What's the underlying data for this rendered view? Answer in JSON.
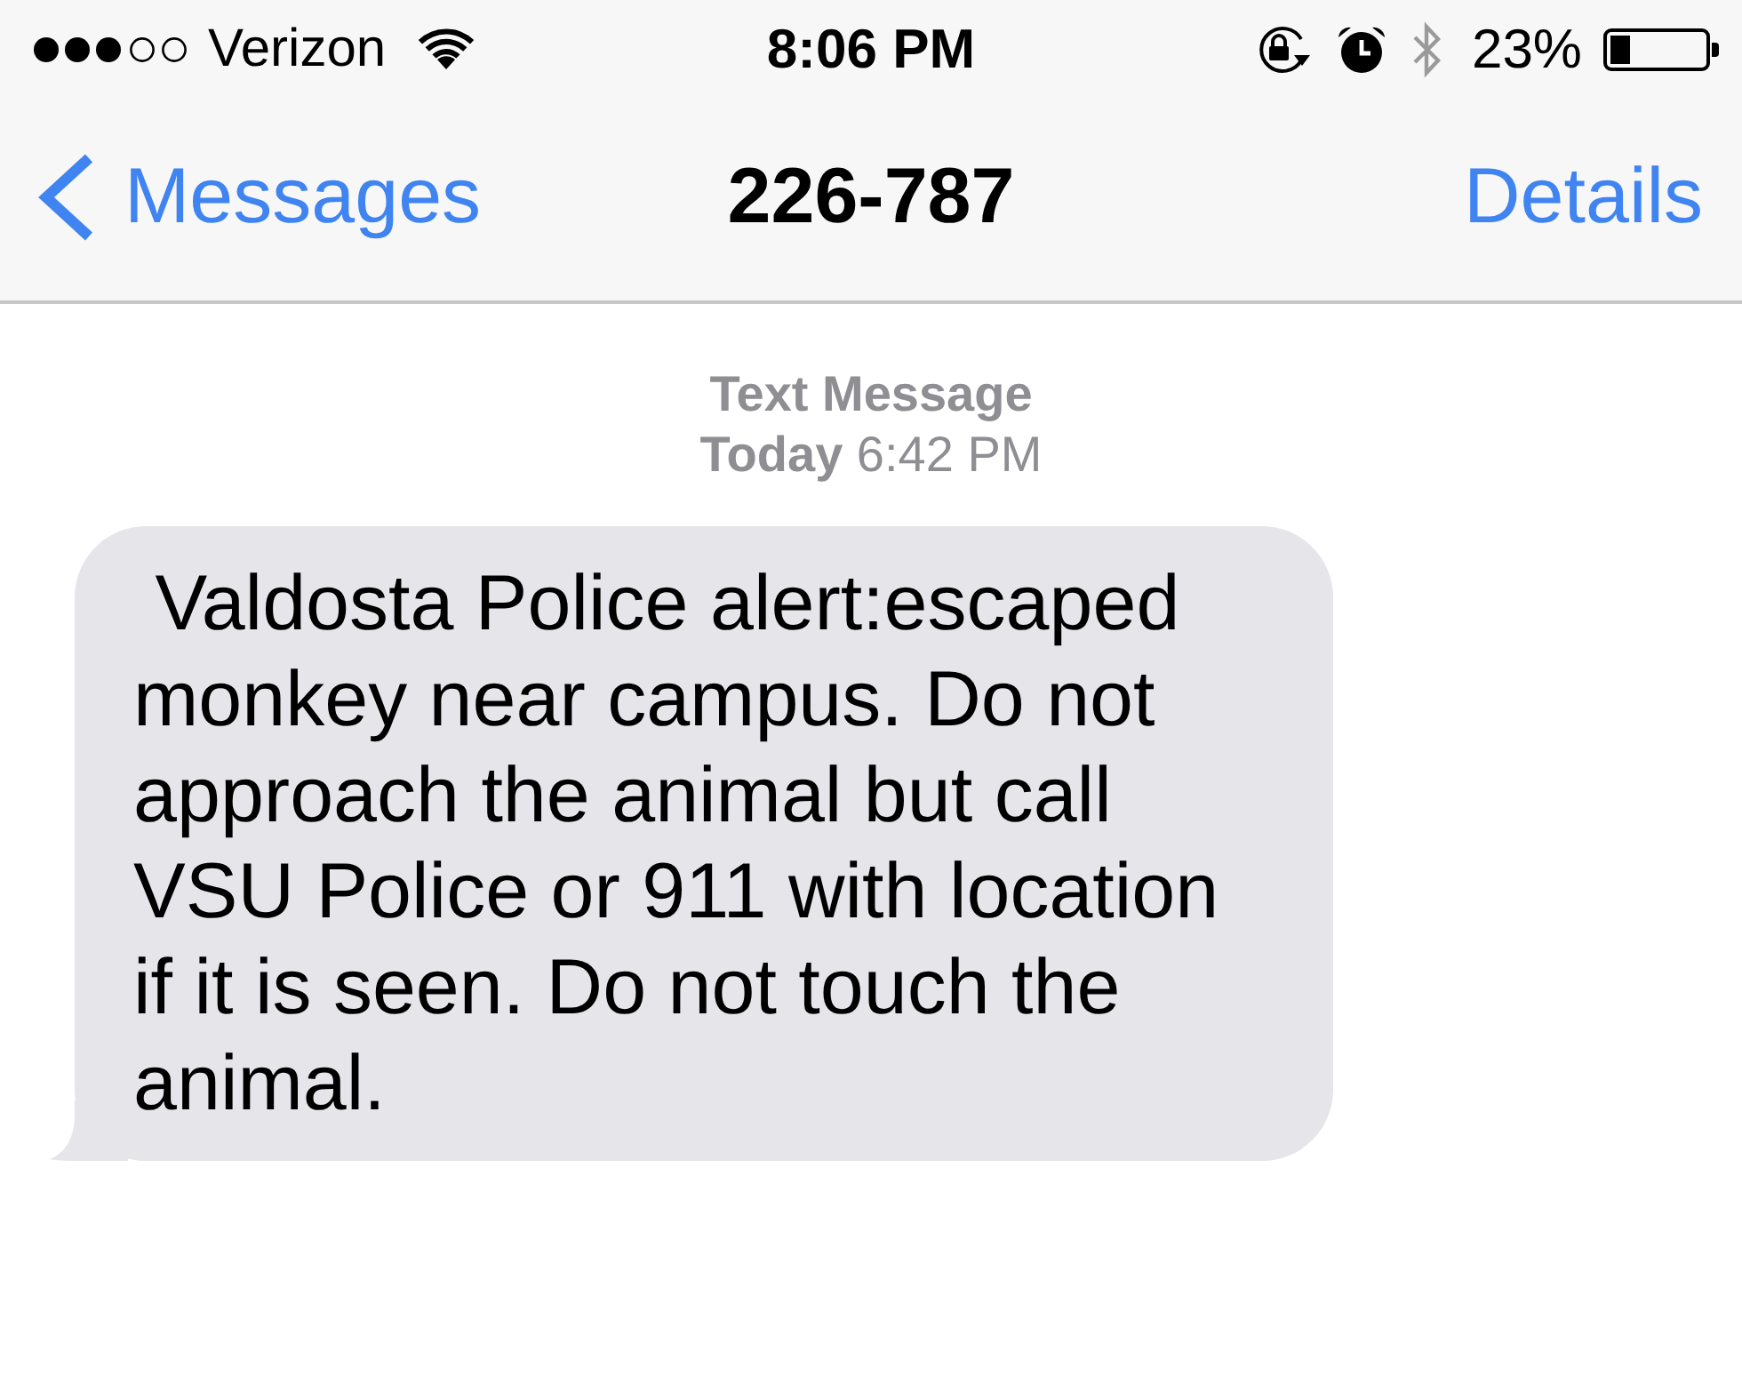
{
  "status_bar": {
    "carrier": "Verizon",
    "time": "8:06 PM",
    "battery": "23%"
  },
  "nav_bar": {
    "back": "Messages",
    "title": "226-787",
    "action": "Details"
  },
  "conversation": {
    "header": "Text Message",
    "timestamp": "**Today** 6:42 PM",
    "messages": [
      {
        "kind": "received",
        "text": " Valdosta Police alert:escaped monkey near campus. Do not approach the animal but call VSU Police or 911 with location if it is seen. Do not touch the animal."
      }
    ]
  }
}
